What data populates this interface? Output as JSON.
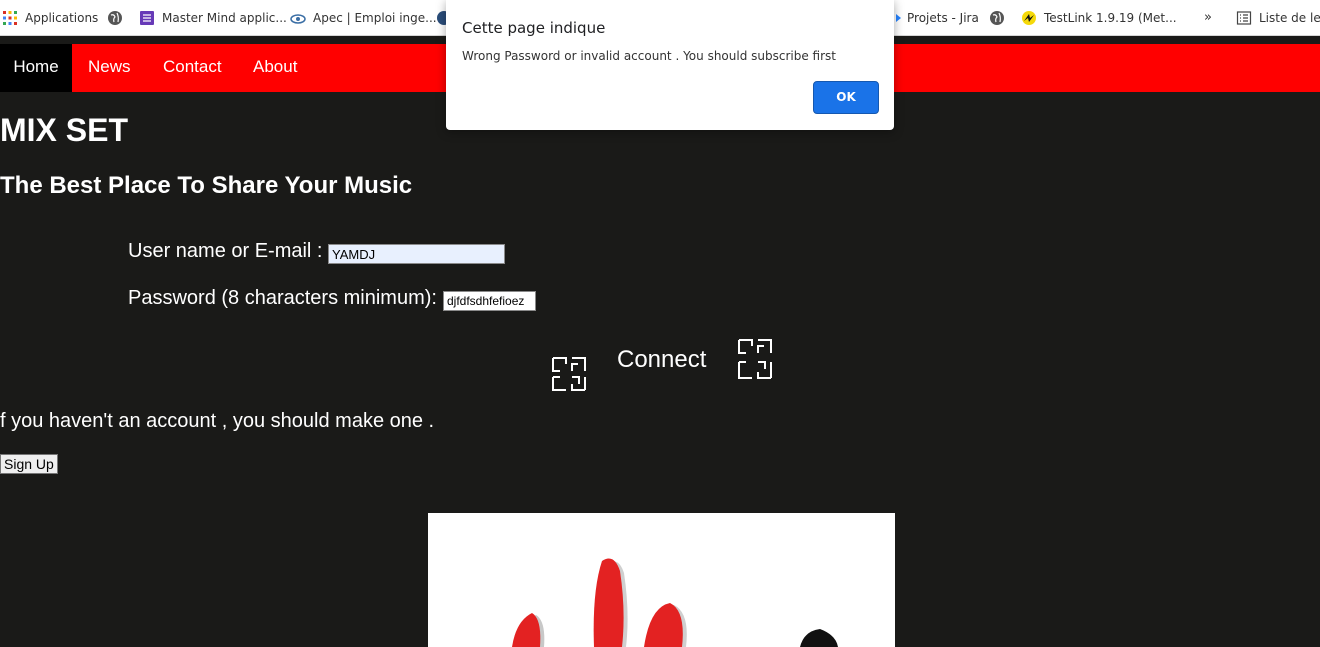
{
  "bookmarks": {
    "apps_label": "Applications",
    "items": [
      {
        "label": "Master Mind applic...",
        "icon": "grid-doc-icon"
      },
      {
        "label": "Apec | Emploi inge...",
        "icon": "apec-icon"
      },
      {
        "label": "Projets - Jira",
        "icon": "jira-icon"
      },
      {
        "label": "TestLink 1.9.19 (Met...",
        "icon": "testlink-icon"
      }
    ],
    "overflow": "»",
    "reading_list": "Liste de lect"
  },
  "nav": {
    "home": "Home",
    "news": "News",
    "contact": "Contact",
    "about": "About"
  },
  "page": {
    "title": "MIX SET",
    "subtitle": "The Best Place To Share Your Music"
  },
  "form": {
    "username_label": "User name or E-mail :",
    "username_value": "YAMDJ",
    "password_label": "Password (8 characters minimum):",
    "password_value": "djfdfsdhfefioez",
    "connect_label": "Connect"
  },
  "signup": {
    "account_text": "f you haven't an account , you should make one .",
    "button_label": "Sign Up"
  },
  "dialog": {
    "title": "Cette page indique",
    "message": "Wrong Password or invalid account . You should subscribe first",
    "ok_label": "OK"
  },
  "colors": {
    "nav_bg": "#ff0000",
    "page_bg": "#1a1a18",
    "dialog_button": "#1a73e8"
  }
}
